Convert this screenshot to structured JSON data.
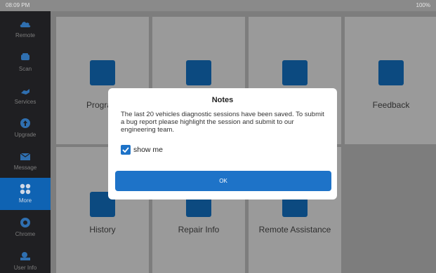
{
  "status_bar": {
    "time": "08:09 PM",
    "battery": "100%"
  },
  "sidebar": {
    "items": [
      {
        "label": "Remote",
        "icon": "cloud-icon"
      },
      {
        "label": "Scan",
        "icon": "car-icon"
      },
      {
        "label": "Services",
        "icon": "hand-icon"
      },
      {
        "label": "Upgrade",
        "icon": "upload-cloud-icon"
      },
      {
        "label": "Message",
        "icon": "envelope-icon"
      },
      {
        "label": "More",
        "icon": "grid-icon",
        "active": true
      },
      {
        "label": "Chrome",
        "icon": "chrome-icon"
      },
      {
        "label": "User Info",
        "icon": "user-settings-icon"
      }
    ]
  },
  "grid": {
    "tiles": [
      {
        "label": "Program",
        "icon": "program-icon"
      },
      {
        "label": "",
        "icon": "wireless-car-icon"
      },
      {
        "label": "",
        "icon": "battery-icon"
      },
      {
        "label": "Feedback",
        "icon": "feedback-icon"
      },
      {
        "label": "History",
        "icon": "history-icon"
      },
      {
        "label": "Repair Info",
        "icon": "repair-info-icon"
      },
      {
        "label": "Remote Assistance",
        "icon": "globe-icon"
      }
    ]
  },
  "dialog": {
    "title": "Notes",
    "message": "The last 20 vehicles diagnostic sessions have been saved. To submit a bug report please highlight the session and submit to our engineering team.",
    "checkbox_label": "show me",
    "checkbox_checked": true,
    "ok_label": "OK"
  },
  "colors": {
    "accent": "#1e73c8",
    "sidebar_bg": "#1f1f22",
    "active_item": "#0f63b3",
    "tile_icon": "#0c4a80",
    "overlay": "#7d7d7d"
  }
}
